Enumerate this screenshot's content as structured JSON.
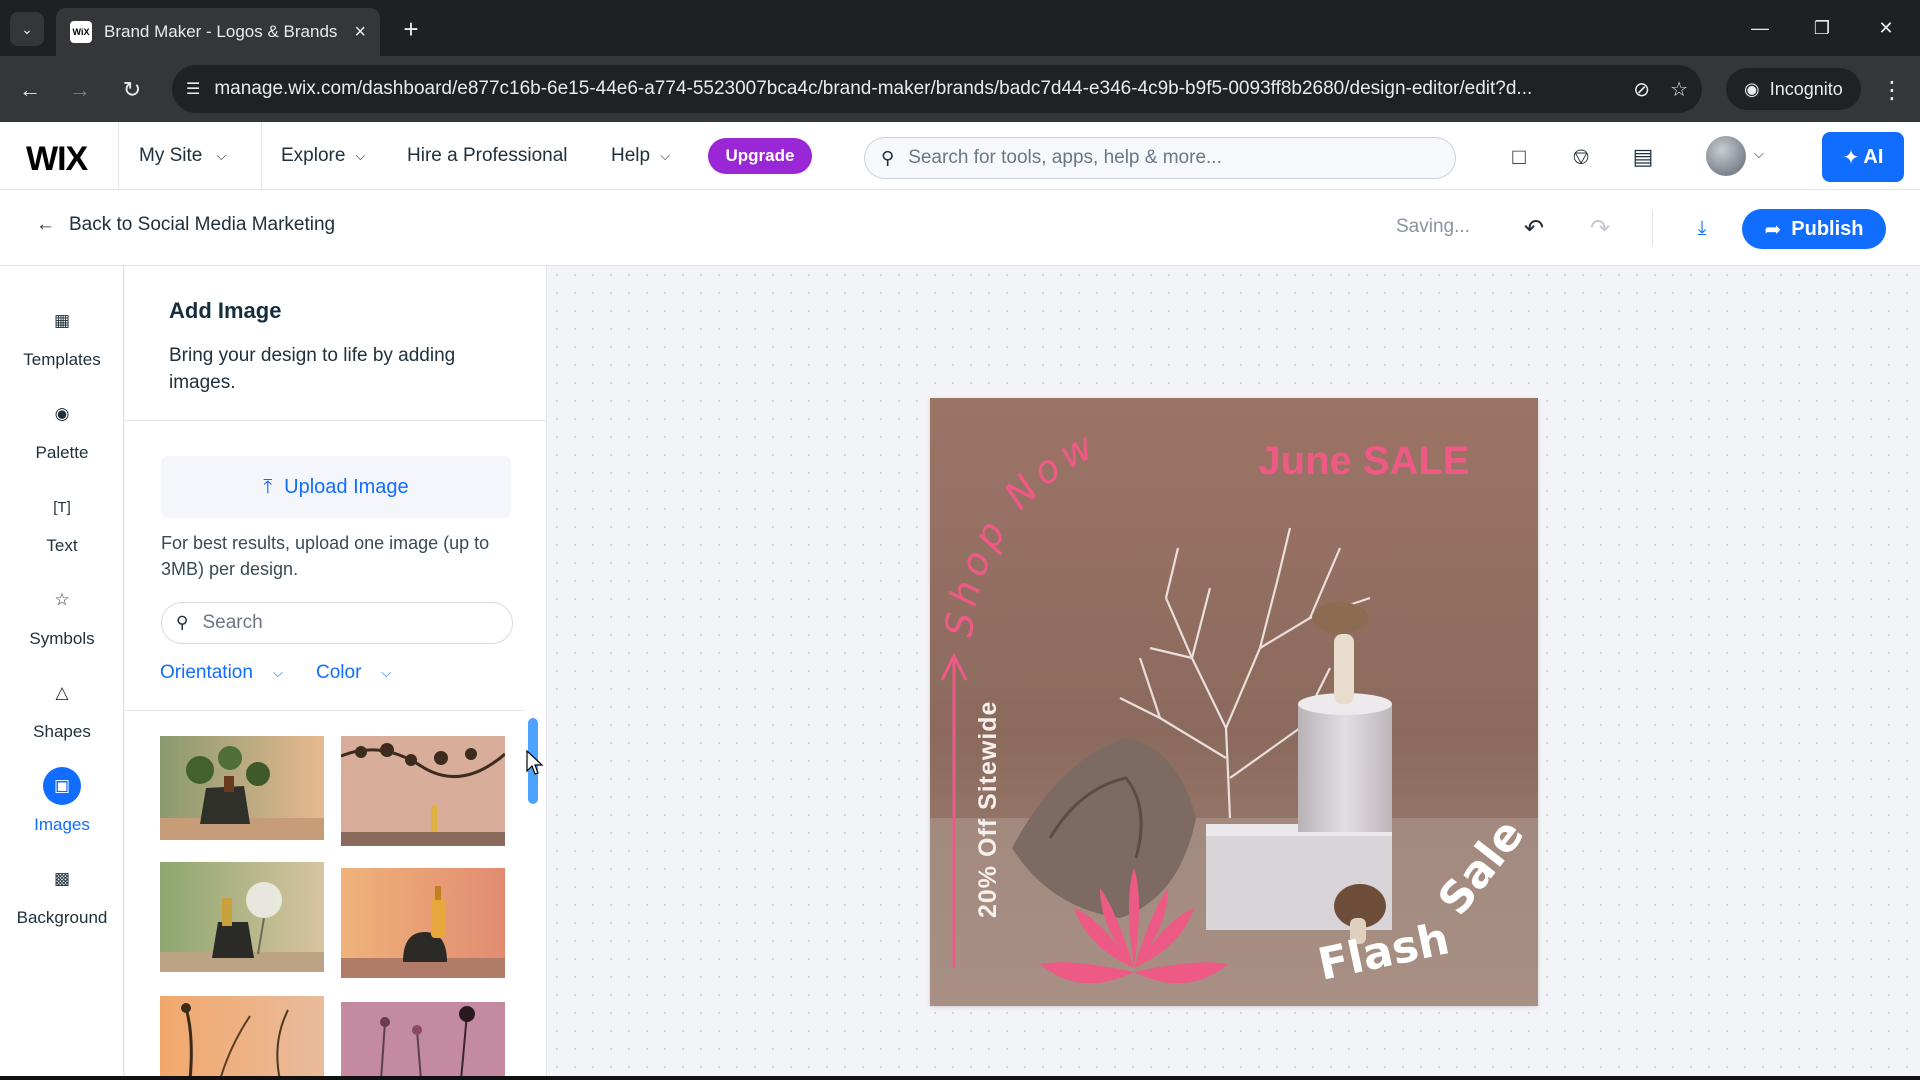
{
  "browser": {
    "tab_title": "Brand Maker - Logos & Brands",
    "favicon_text": "WiX",
    "url": "manage.wix.com/dashboard/e877c16b-6e15-44e6-a774-5523007bca4c/brand-maker/brands/badc7d44-e346-4c9b-b9f5-0093ff8b2680/design-editor/edit?d...",
    "incognito_label": "Incognito"
  },
  "wix_topbar": {
    "logo": "WIX",
    "my_site": "My Site",
    "nav": [
      {
        "label": "Explore"
      },
      {
        "label": "Hire a Professional"
      },
      {
        "label": "Help"
      }
    ],
    "upgrade_label": "Upgrade",
    "search_placeholder": "Search for tools, apps, help & more...",
    "ai_label": "AI"
  },
  "editor_header": {
    "back_label": "Back to Social Media Marketing",
    "status": "Saving...",
    "publish_label": "Publish"
  },
  "rail": {
    "items": [
      {
        "label": "Templates",
        "icon": "templates-icon"
      },
      {
        "label": "Palette",
        "icon": "palette-icon"
      },
      {
        "label": "Text",
        "icon": "text-icon"
      },
      {
        "label": "Symbols",
        "icon": "star-icon"
      },
      {
        "label": "Shapes",
        "icon": "shapes-icon"
      },
      {
        "label": "Images",
        "icon": "image-icon",
        "active": true
      },
      {
        "label": "Background",
        "icon": "background-icon"
      }
    ]
  },
  "panel": {
    "title": "Add Image",
    "description": "Bring your design to life by adding images.",
    "upload_label": "Upload Image",
    "upload_note": "For best results, upload one image (up to 3MB) per design.",
    "search_placeholder": "Search",
    "filters": [
      {
        "label": "Orientation"
      },
      {
        "label": "Color"
      }
    ]
  },
  "design": {
    "headline": "June SALE",
    "arc_text": "Shop Now",
    "side_text": "20% Off Sitewide",
    "corner_text_1": "Flash",
    "corner_text_2": "Sale"
  },
  "colors": {
    "accent": "#116dff",
    "upgrade": "#9a27d5",
    "design_pink": "#ee5a86"
  }
}
